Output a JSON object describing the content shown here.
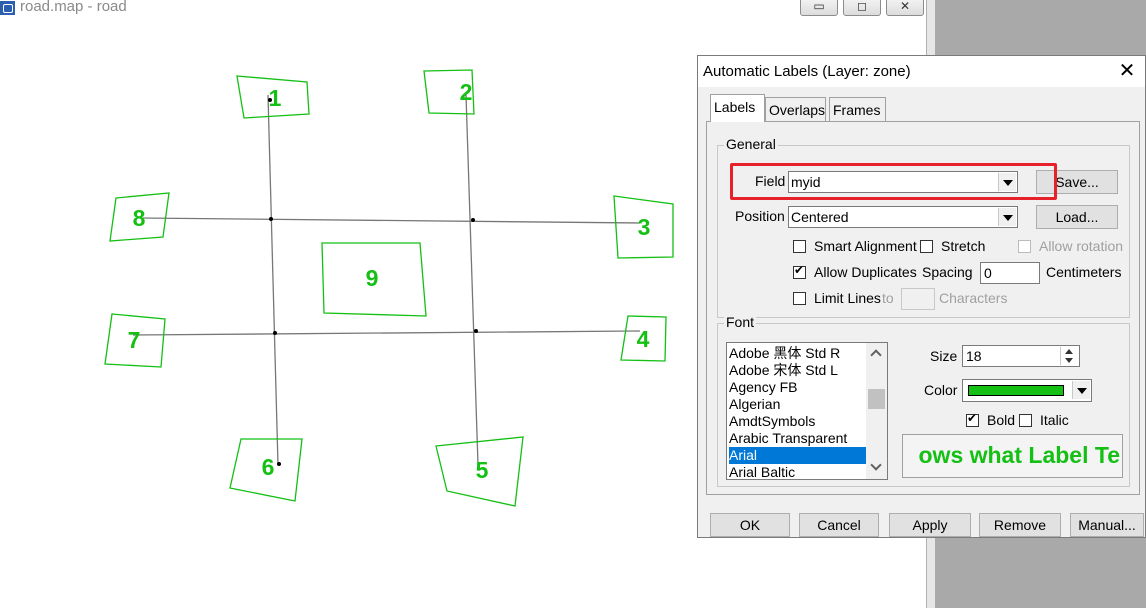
{
  "window": {
    "title": "road.map - road",
    "minimize_glyph": "▭",
    "maximize_glyph": "◻",
    "close_glyph": "✕"
  },
  "map": {
    "label_color": "#13c013",
    "zone_labels": [
      "1",
      "2",
      "3",
      "4",
      "5",
      "6",
      "7",
      "8",
      "9"
    ]
  },
  "dialog": {
    "title": "Automatic Labels (Layer: zone)",
    "close_glyph": "✕",
    "tabs": [
      "Labels",
      "Overlaps",
      "Frames"
    ],
    "active_tab": "Labels",
    "general": {
      "group_title": "General",
      "field_label": "Field",
      "field_value": "myid",
      "position_label": "Position",
      "position_value": "Centered",
      "save_button": "Save...",
      "load_button": "Load...",
      "smart_alignment": {
        "label": "Smart Alignment",
        "checked": false
      },
      "stretch": {
        "label": "Stretch",
        "checked": false
      },
      "allow_rotation": {
        "label": "Allow rotation",
        "checked": false,
        "enabled": false
      },
      "allow_duplicates": {
        "label": "Allow Duplicates",
        "checked": true
      },
      "spacing_label": "Spacing",
      "spacing_value": "0",
      "spacing_unit": "Centimeters",
      "limit_lines": {
        "label": "Limit Lines",
        "checked": false
      },
      "to_label": "to",
      "characters_label": "Characters",
      "limit_value": ""
    },
    "font": {
      "group_title": "Font",
      "font_list": [
        "Adobe 黑体 Std R",
        "Adobe 宋体 Std L",
        "Agency FB",
        "Algerian",
        "AmdtSymbols",
        "Arabic Transparent",
        "Arial",
        "Arial Baltic"
      ],
      "selected_font": "Arial",
      "size_label": "Size",
      "size_value": "18",
      "color_label": "Color",
      "color_value": "#13c013",
      "bold": {
        "label": "Bold",
        "checked": true
      },
      "italic": {
        "label": "Italic",
        "checked": false
      },
      "preview_text": "ows what Label Te"
    },
    "buttons": {
      "ok": "OK",
      "cancel": "Cancel",
      "apply": "Apply",
      "remove": "Remove",
      "manual": "Manual..."
    }
  }
}
